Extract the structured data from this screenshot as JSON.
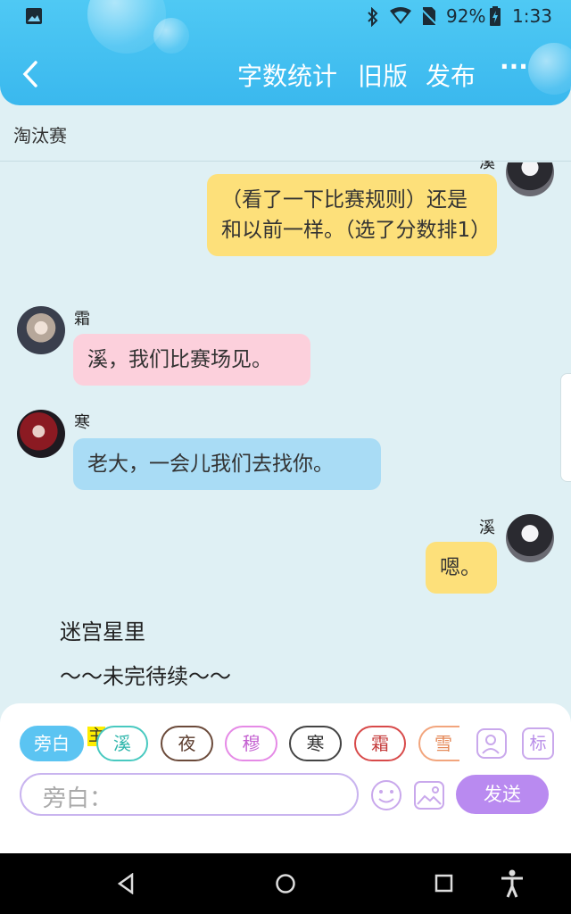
{
  "status_bar": {
    "battery": "92%",
    "time": "1:33"
  },
  "header": {
    "word_count": "字数统计",
    "old_version": "旧版",
    "publish": "发布",
    "more": "···"
  },
  "contest_label": "淘汰赛",
  "messages": {
    "m1_name": "溪",
    "m1_text": "（看了一下比赛规则）还是和以前一样。（选了分数排1）",
    "m2_name": "霜",
    "m2_text": "溪，我们比赛场见。",
    "m3_name": "寒",
    "m3_text": "老大，一会儿我们去找你。",
    "m4_name": "溪",
    "m4_text": "嗯。",
    "narration1": "迷宫星里",
    "narration2": "～～未完待续～～"
  },
  "roles": {
    "narrator": "旁白",
    "main_badge": "主",
    "xi": "溪",
    "ye": "夜",
    "mu": "穆",
    "han": "寒",
    "shuang": "霜",
    "xue": "雪",
    "tag": "标"
  },
  "input": {
    "placeholder": "旁白："
  },
  "send_label": "发送",
  "colors": {
    "header": "#3ab8ee",
    "self_bubble": "#fde07a",
    "pink_bubble": "#fcd0dc",
    "blue_bubble": "#a9dcf5",
    "send": "#b98af0"
  }
}
